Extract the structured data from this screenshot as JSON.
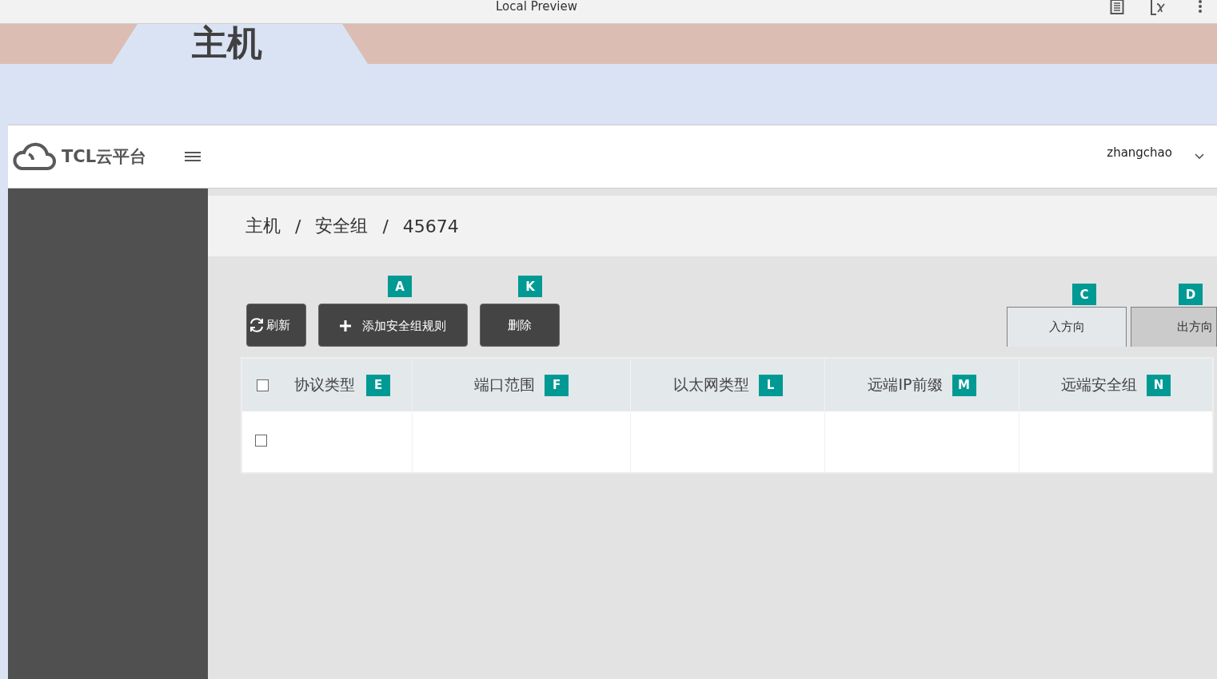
{
  "preview_bar": {
    "title": "Local Preview"
  },
  "page_tab": {
    "label": "主机",
    "selected": true
  },
  "header": {
    "brand": "TCL云平台",
    "user": "zhangchao"
  },
  "breadcrumb": {
    "items": [
      "主机",
      "安全组",
      "45674"
    ],
    "separator": "/"
  },
  "toolbar": [
    {
      "kind": "refresh",
      "label": "刷新"
    },
    {
      "kind": "add",
      "label": "添加安全组规则",
      "annotation": "A"
    },
    {
      "kind": "plain",
      "label": "删除",
      "annotation": "K"
    }
  ],
  "direction_tabs": [
    {
      "label": "入方向",
      "selected": true,
      "annotation": "C"
    },
    {
      "label": "出方向",
      "selected": false,
      "annotation": "D"
    }
  ],
  "table": {
    "select_all_checked": false,
    "columns": [
      {
        "label": "协议类型",
        "annotation": "E"
      },
      {
        "label": "端口范围",
        "annotation": "F"
      },
      {
        "label": "以太网类型",
        "annotation": "L"
      },
      {
        "label": "远端IP前缀",
        "annotation": "M"
      },
      {
        "label": "远端安全组",
        "annotation": "N"
      }
    ],
    "rows": [
      {
        "checked": false
      }
    ]
  }
}
